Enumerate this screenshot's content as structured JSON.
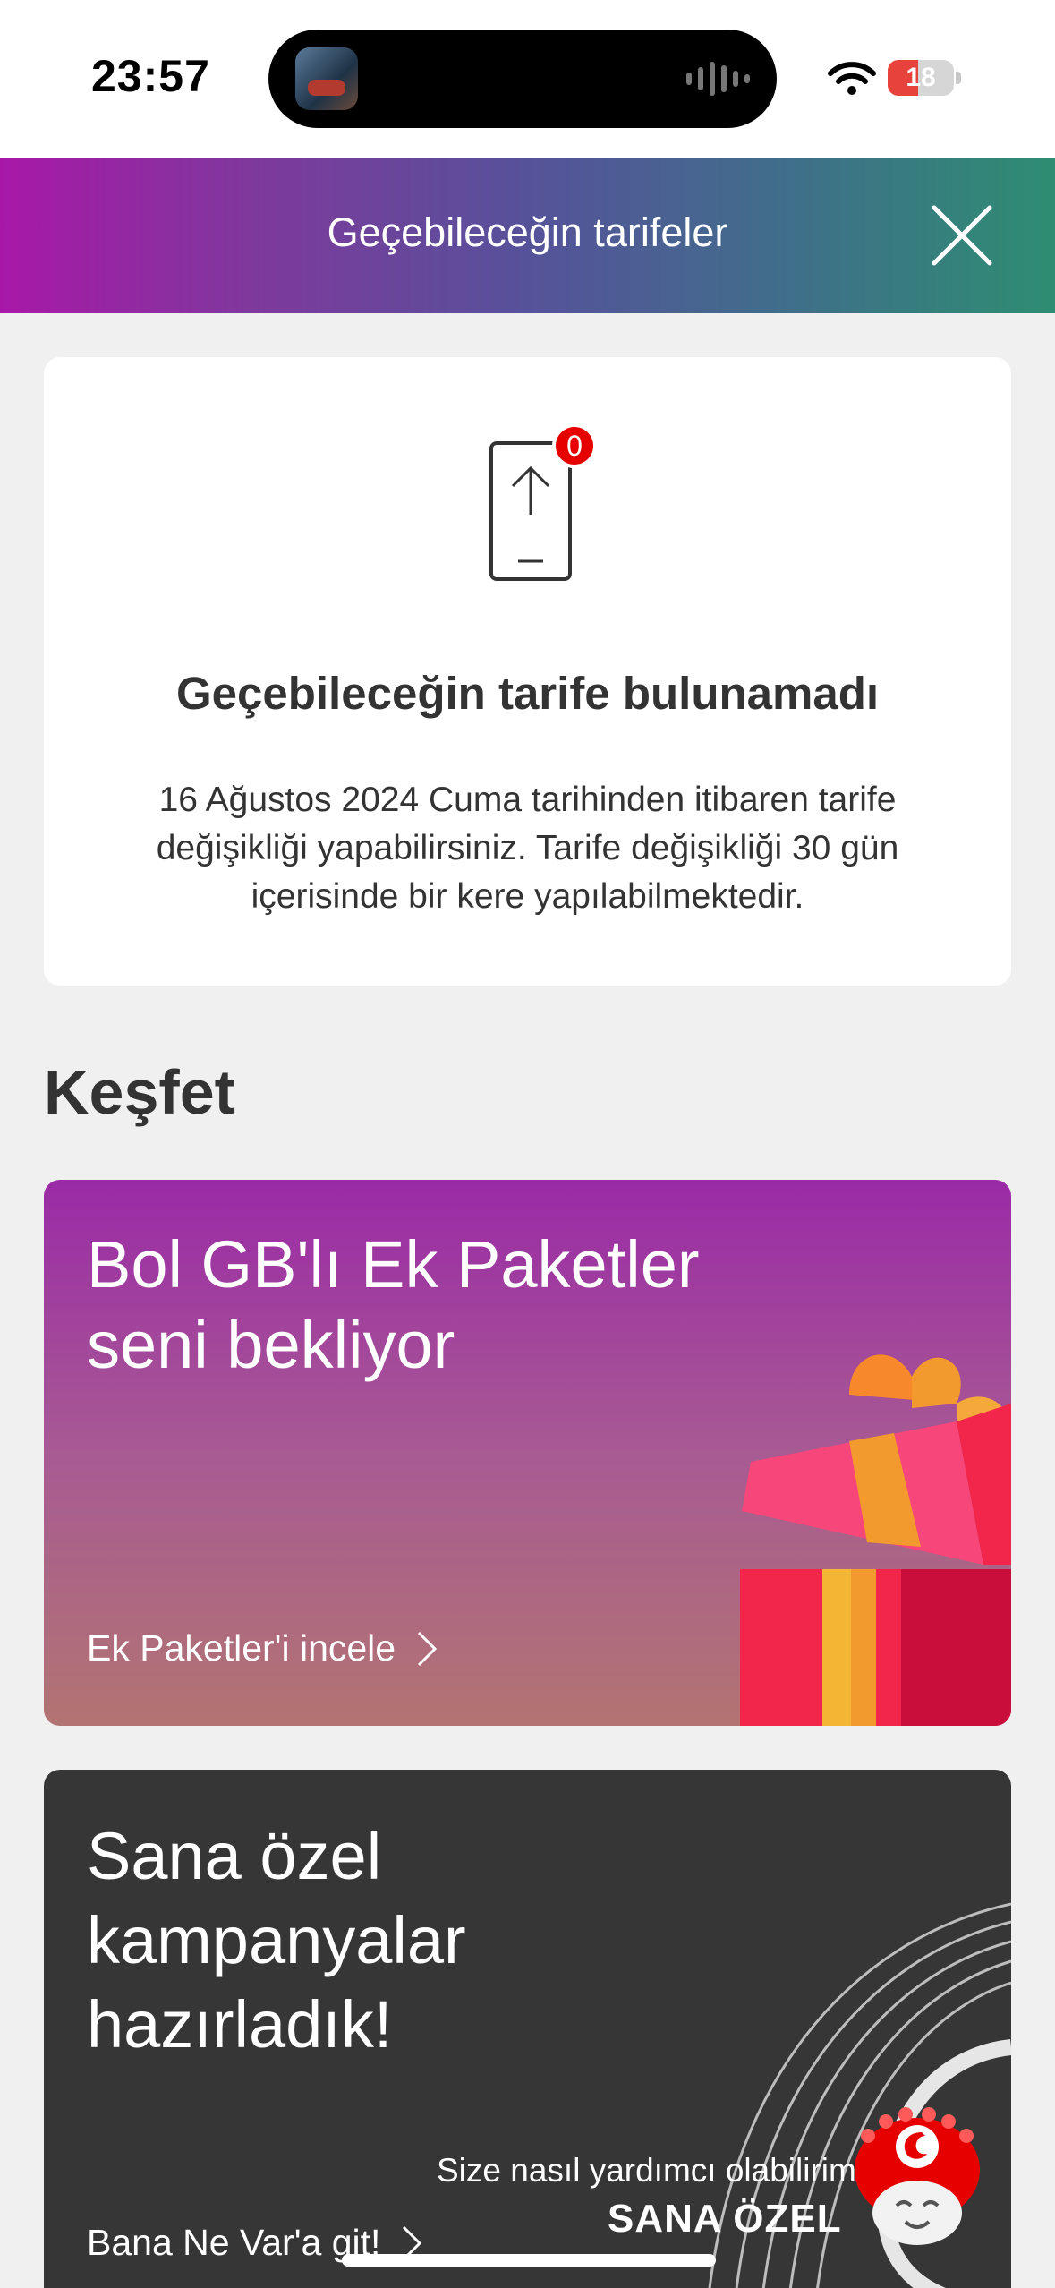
{
  "status_bar": {
    "time": "23:57",
    "battery_level": "18",
    "wifi_icon": "wifi-icon",
    "battery_color": "#e8423c"
  },
  "header": {
    "title": "Geçebileceğin tarifeler",
    "close_icon": "close-icon",
    "gradient": [
      "#a818a8",
      "#2e8d72"
    ]
  },
  "info_card": {
    "icon": "phone-upload-icon",
    "badge": "0",
    "title": "Geçebileceğin tarife bulunamadı",
    "description": "16 Ağustos 2024 Cuma tarihinden itibaren tarife değişikliği yapabilirsiniz. Tarife değişikliği 30 gün içerisinde bir kere yapılabilmektedir."
  },
  "discover": {
    "title": "Keşfet",
    "cards": [
      {
        "title": "Bol GB'lı Ek Paketler seni bekliyor",
        "link": "Ek Paketler'i incele",
        "icon": "gift-icon"
      },
      {
        "title": "Sana özel kampanyalar hazırladık!",
        "link": "Bana Ne Var'a git!",
        "logo_text": "SANA ÖZEL",
        "icon": "circles-icon"
      }
    ]
  },
  "chat": {
    "prompt": "Size nasıl yardımcı olabilirim?",
    "icon": "assistant-bot-icon",
    "accent": "#e60000"
  }
}
